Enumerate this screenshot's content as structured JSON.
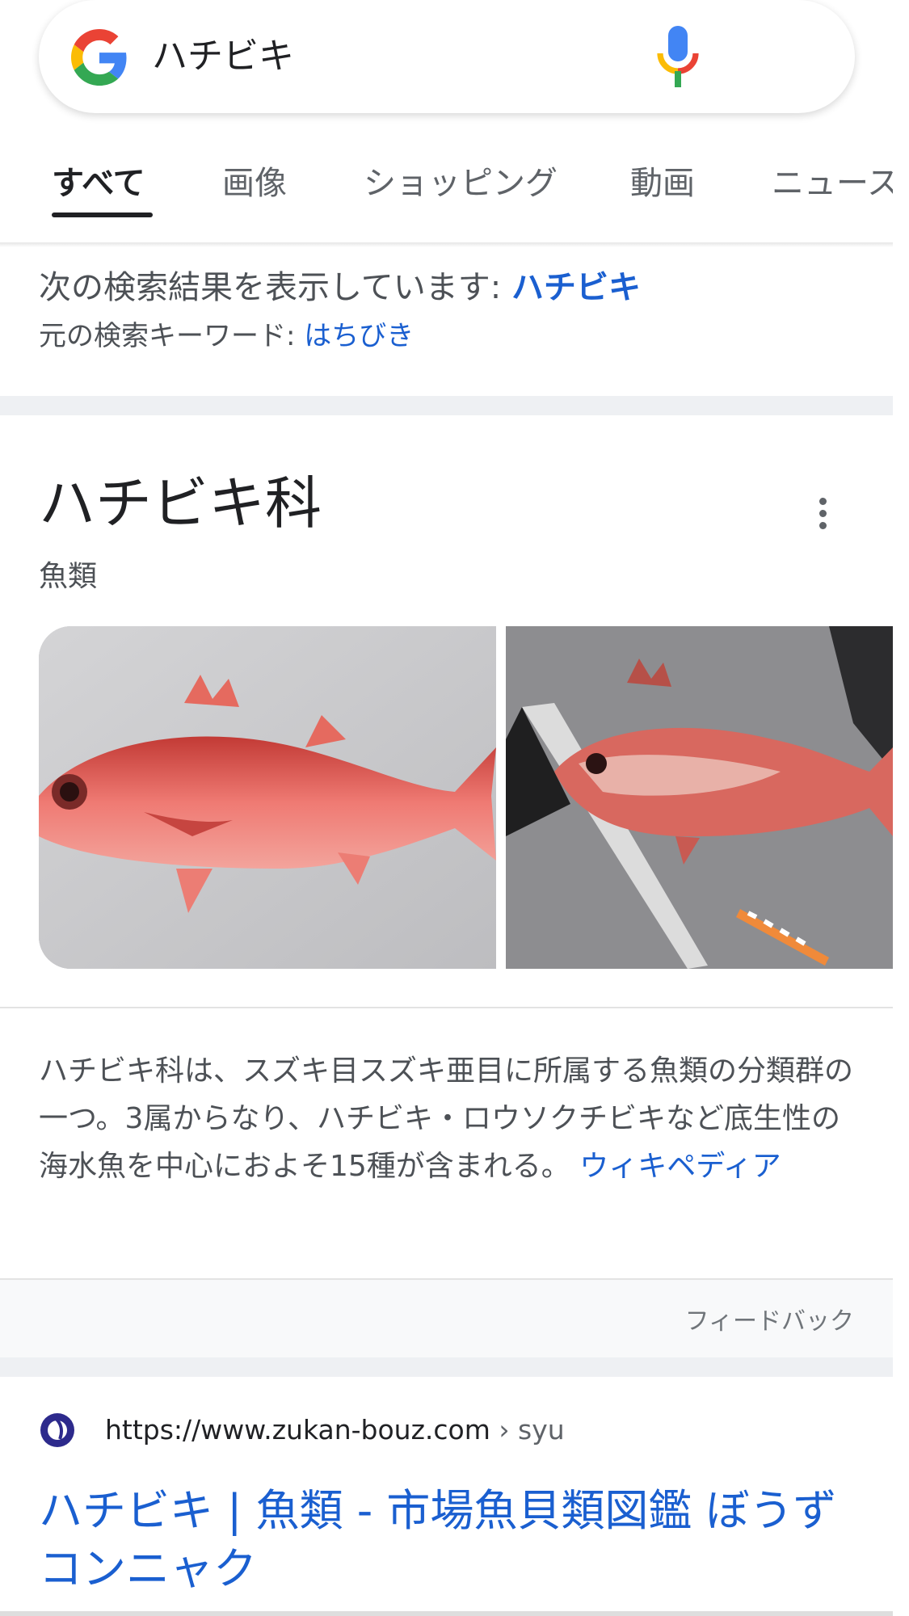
{
  "search": {
    "query": "ハチビキ"
  },
  "tabs": [
    {
      "label": "すべて",
      "active": true
    },
    {
      "label": "画像"
    },
    {
      "label": "ショッピング"
    },
    {
      "label": "動画"
    },
    {
      "label": "ニュース"
    }
  ],
  "spelling": {
    "showing_prefix": "次の検索結果を表示しています: ",
    "showing_term": "ハチビキ",
    "original_prefix": "元の検索キーワード: ",
    "original_term": "はちびき"
  },
  "knowledge_panel": {
    "title": "ハチビキ科",
    "subtitle": "魚類",
    "description": "ハチビキ科は、スズキ目スズキ亜目に所属する魚類の分類群の一つ。3属からなり、ハチビキ・ロウソクチビキなど底生性の海水魚を中心におよそ15種が含まれる。 ",
    "source_link": "ウィキペディア",
    "feedback": "フィードバック"
  },
  "result": {
    "url_base": "https://www.zukan-bouz.com",
    "url_path": " › syu",
    "title": "ハチビキ | 魚類 - 市場魚貝類図鑑 ぼうずコンニャク"
  },
  "colors": {
    "link": "#1a5fd0",
    "google_blue": "#4285F4",
    "google_red": "#EA4335",
    "google_yellow": "#FBBC05",
    "google_green": "#34A853",
    "fish_red": "#e2504a"
  }
}
